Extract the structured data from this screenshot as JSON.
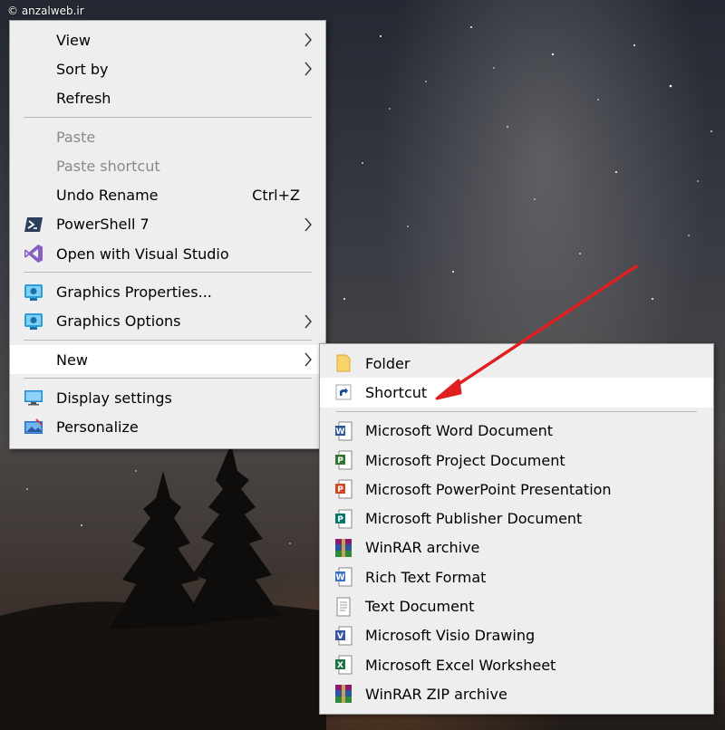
{
  "watermark": "© anzalweb.ir",
  "context_menu": {
    "items": [
      {
        "label": "View"
      },
      {
        "label": "Sort by"
      },
      {
        "label": "Refresh"
      },
      {
        "label": "Paste"
      },
      {
        "label": "Paste shortcut"
      },
      {
        "label": "Undo Rename",
        "shortcut": "Ctrl+Z"
      },
      {
        "label": "PowerShell 7"
      },
      {
        "label": "Open with Visual Studio"
      },
      {
        "label": "Graphics Properties..."
      },
      {
        "label": "Graphics Options"
      },
      {
        "label": "New"
      },
      {
        "label": "Display settings"
      },
      {
        "label": "Personalize"
      }
    ]
  },
  "new_submenu": {
    "items": [
      {
        "label": "Folder"
      },
      {
        "label": "Shortcut"
      },
      {
        "label": "Microsoft Word Document"
      },
      {
        "label": "Microsoft Project Document"
      },
      {
        "label": "Microsoft PowerPoint Presentation"
      },
      {
        "label": "Microsoft Publisher Document"
      },
      {
        "label": "WinRAR archive"
      },
      {
        "label": "Rich Text Format"
      },
      {
        "label": "Text Document"
      },
      {
        "label": "Microsoft Visio Drawing"
      },
      {
        "label": "Microsoft Excel Worksheet"
      },
      {
        "label": "WinRAR ZIP archive"
      }
    ]
  },
  "colors": {
    "menu_bg": "#eeeeee",
    "highlight_bg": "#ffffff",
    "disabled_text": "#8a8a8a",
    "annotation_arrow": "#e02020"
  }
}
